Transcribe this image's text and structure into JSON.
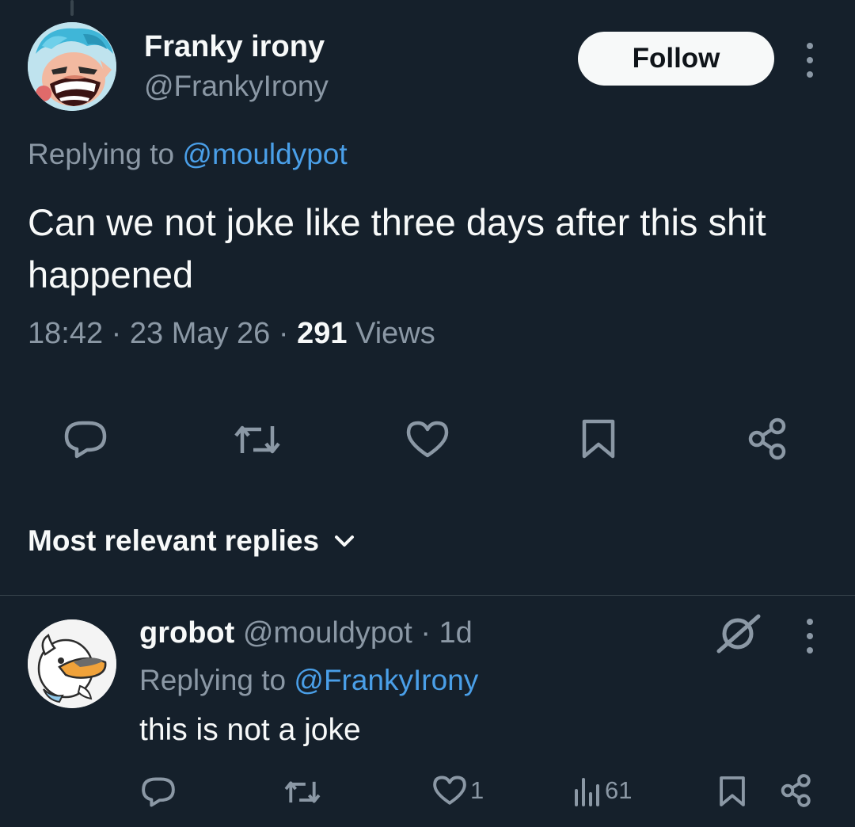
{
  "tweet": {
    "author_name": "Franky irony",
    "author_handle": "@FrankyIrony",
    "follow_label": "Follow",
    "replying_prefix": "Replying to ",
    "replying_handle": "@mouldypot",
    "text": "Can we not joke like three days after this shit happened",
    "time": "18:42",
    "date": "23 May 26",
    "views_count": "291",
    "views_label": "Views",
    "icons": [
      "reply-icon",
      "retweet-icon",
      "like-icon",
      "bookmark-icon",
      "share-icon"
    ]
  },
  "sort": {
    "label": "Most relevant replies"
  },
  "reply": {
    "author_name": "grobot",
    "author_handle": "@mouldypot",
    "age": "1d",
    "replying_prefix": "Replying to ",
    "replying_handle": "@FrankyIrony",
    "text": "this is not a joke",
    "likes": "1",
    "views": "61",
    "icons": [
      "reply-icon",
      "retweet-icon",
      "like-icon",
      "views-icon",
      "bookmark-icon",
      "share-icon",
      "grok-icon",
      "more-icon"
    ]
  },
  "colors": {
    "background": "#15202b",
    "text": "#f7f9f9",
    "muted": "#8b98a5",
    "link": "#4a9fe8",
    "divider": "#38444d"
  }
}
